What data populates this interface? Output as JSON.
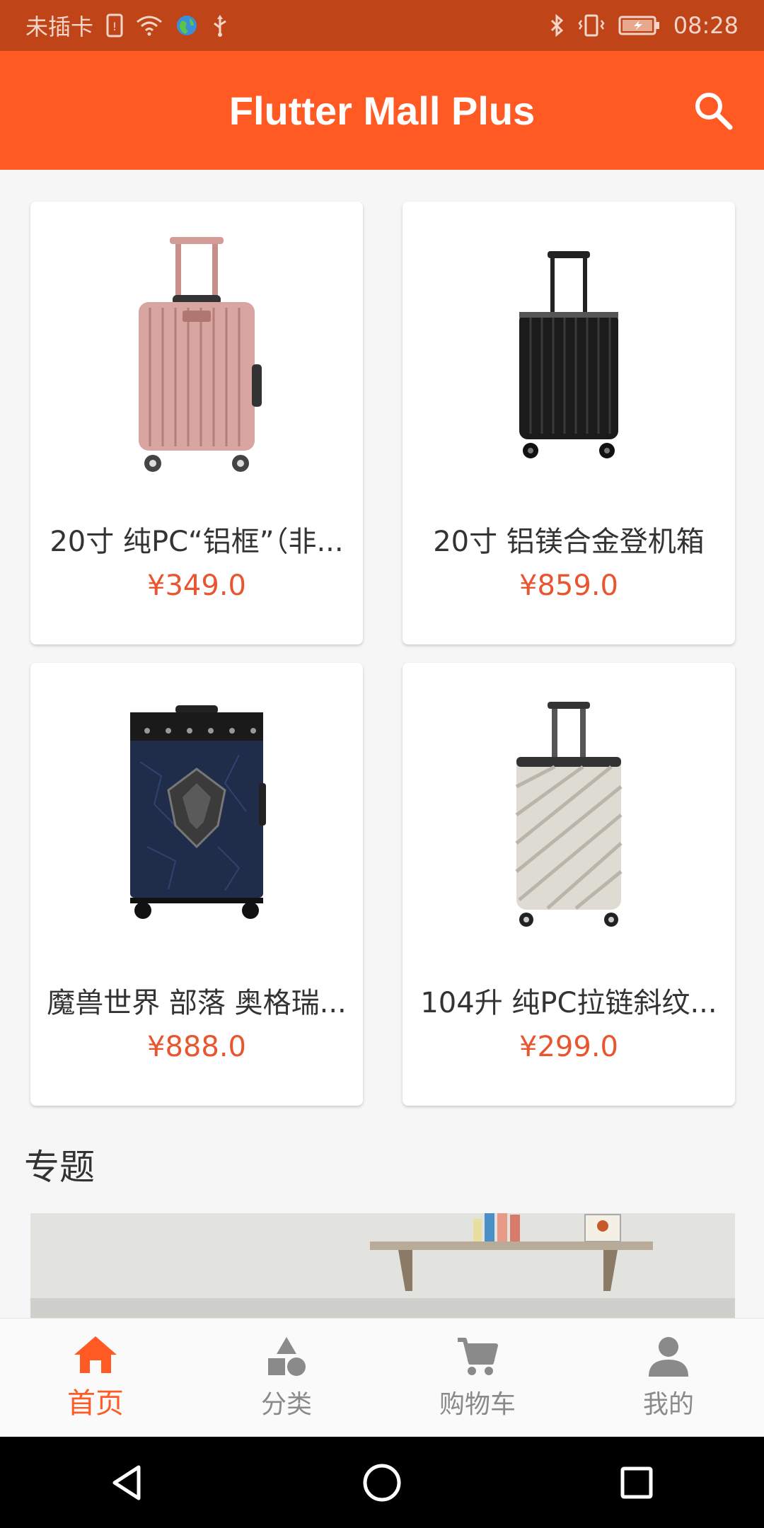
{
  "status_bar": {
    "carrier": "未插卡",
    "time": "08:28",
    "icons": [
      "sim-icon",
      "wifi-icon",
      "globe-icon",
      "usb-icon",
      "bluetooth-icon",
      "vibrate-icon",
      "battery-icon"
    ]
  },
  "app_bar": {
    "title": "Flutter Mall Plus",
    "search_icon": "search-icon"
  },
  "products": [
    {
      "name": "20寸 纯PC“铝框”（非...",
      "price": "¥349.0",
      "image": "pink-suitcase"
    },
    {
      "name": "20寸 铝镁合金登机箱",
      "price": "¥859.0",
      "image": "black-suitcase"
    },
    {
      "name": "魔兽世界 部落 奥格瑞...",
      "price": "¥888.0",
      "image": "blue-warcraft-suitcase"
    },
    {
      "name": "104升 纯PC拉链斜纹...",
      "price": "¥299.0",
      "image": "beige-striped-suitcase"
    }
  ],
  "topic_section": {
    "title": "专题"
  },
  "bottom_nav": [
    {
      "label": "首页",
      "icon": "home-icon",
      "active": true
    },
    {
      "label": "分类",
      "icon": "category-icon",
      "active": false
    },
    {
      "label": "购物车",
      "icon": "cart-icon",
      "active": false
    },
    {
      "label": "我的",
      "icon": "person-icon",
      "active": false
    }
  ],
  "system_nav": [
    "back-icon",
    "home-circle-icon",
    "recents-icon"
  ],
  "colors": {
    "primary": "#ff5a24",
    "status_bar": "#bf4519",
    "price": "#e8552f",
    "inactive": "#8a8a8a"
  }
}
